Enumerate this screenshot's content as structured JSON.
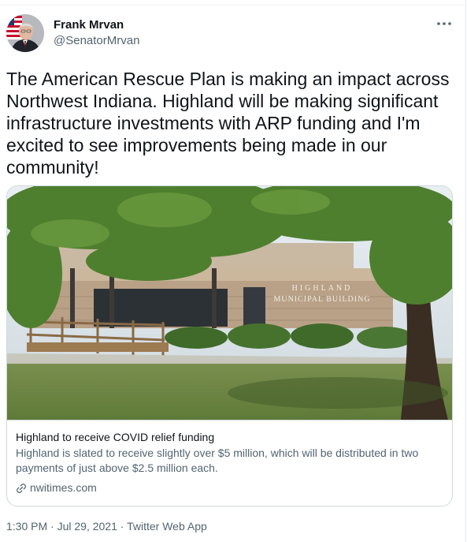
{
  "author": {
    "display_name": "Frank Mrvan",
    "handle": "@SenatorMrvan"
  },
  "tweet": {
    "text": "The American Rescue Plan is making an impact across\nNorthwest Indiana. Highland will be making significant\ninfrastructure investments with ARP funding and I'm\nexcited to see improvements being made in our\ncommunity!"
  },
  "card": {
    "image_sign_line1": "HIGHLAND",
    "image_sign_line2": "MUNICIPAL BUILDING",
    "title": "Highland to receive COVID relief funding",
    "description": "Highland is slated to receive slightly over $5 million, which will be distributed in two payments of just above $2.5 million each.",
    "source": "nwitimes.com"
  },
  "meta": {
    "time": "1:30 PM",
    "separator": "·",
    "date": "Jul 29, 2021",
    "client": "Twitter Web App"
  },
  "icons": {
    "more": "more-icon",
    "link": "link-icon"
  },
  "colors": {
    "text_primary": "#0f1419",
    "text_secondary": "#536471",
    "border": "#cfd9de"
  }
}
